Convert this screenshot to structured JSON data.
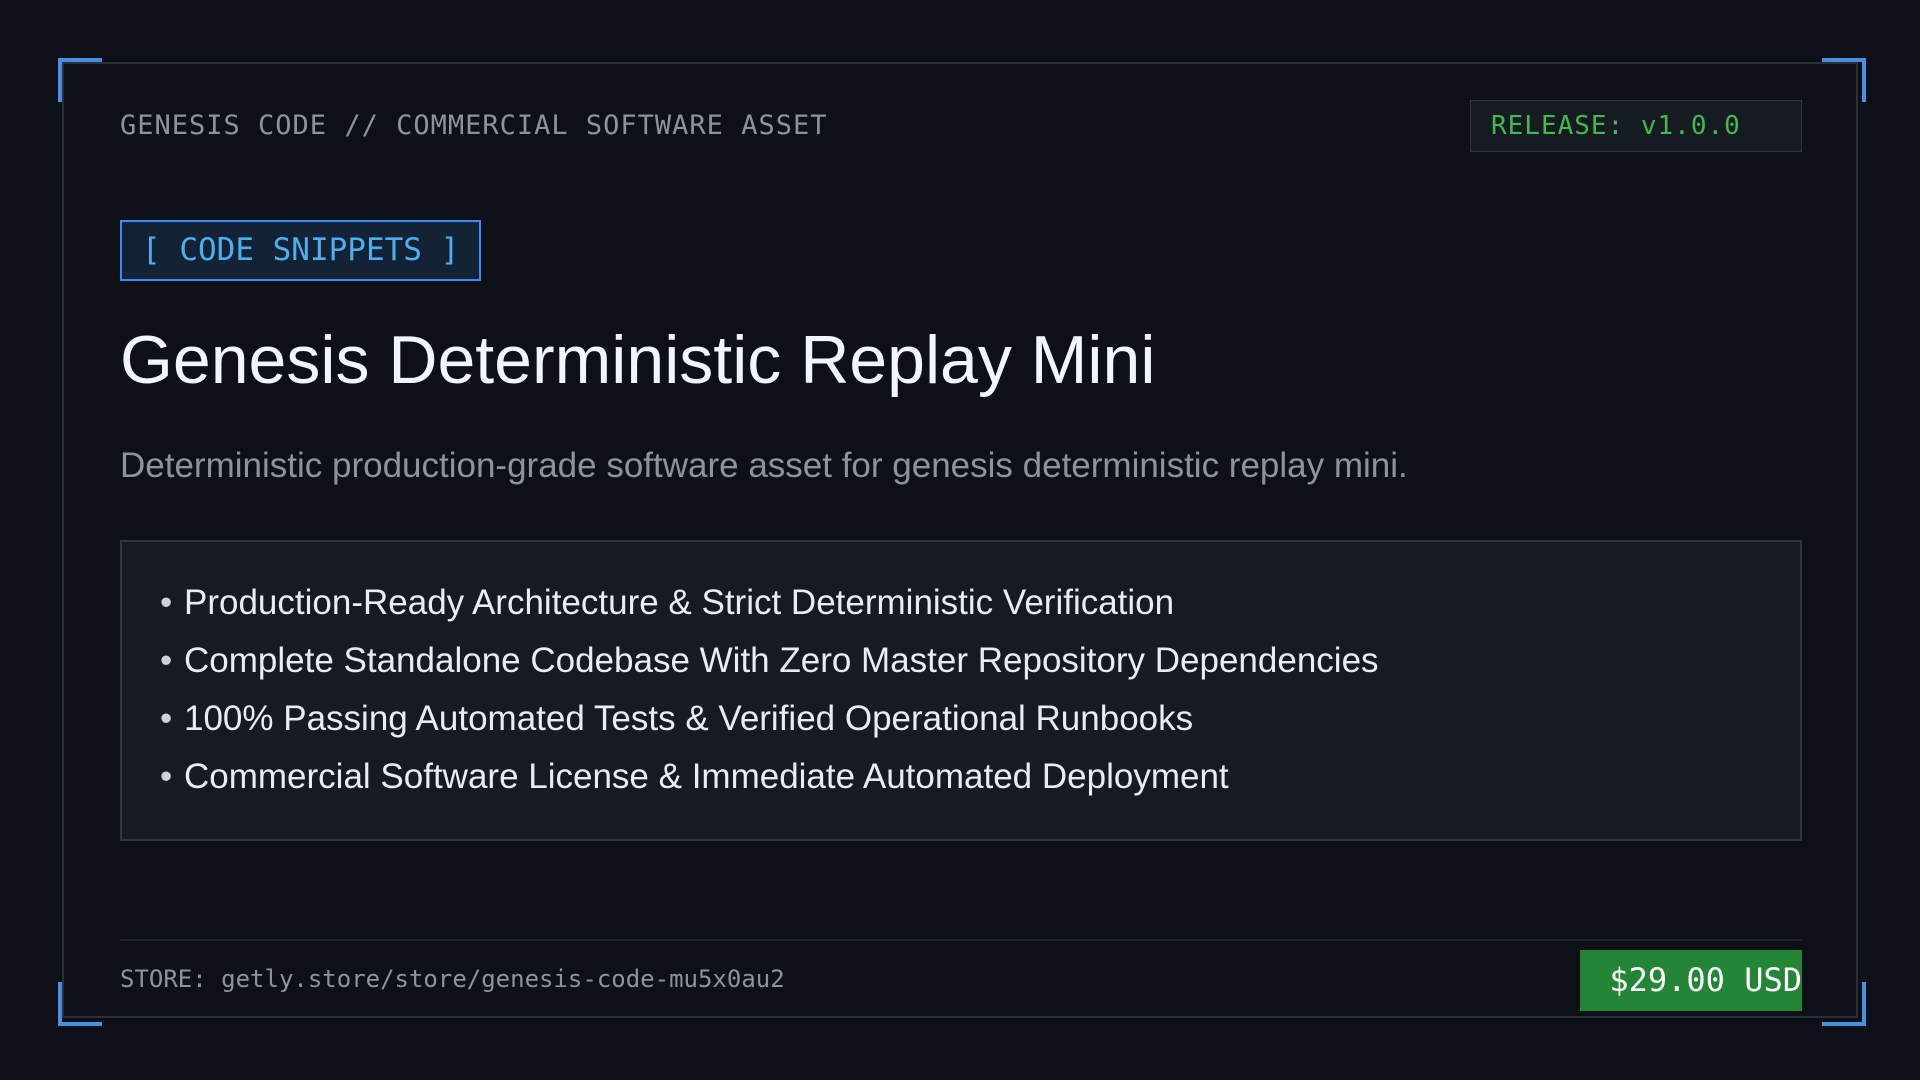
{
  "header": {
    "label": "GENESIS CODE // COMMERCIAL SOFTWARE ASSET",
    "release": "RELEASE: v1.0.0"
  },
  "product": {
    "category": "[ CODE SNIPPETS ]",
    "title": "Genesis Deterministic Replay Mini",
    "subtitle": "Deterministic production-grade software asset for genesis deterministic replay mini.",
    "features": [
      "Production-Ready Architecture & Strict Deterministic Verification",
      "Complete Standalone Codebase With Zero Master Repository Dependencies",
      "100% Passing Automated Tests & Verified Operational Runbooks",
      "Commercial Software License & Immediate Automated Deployment"
    ]
  },
  "footer": {
    "store": "STORE: getly.store/store/genesis-code-mu5x0au2",
    "price": "$29.00 USD"
  },
  "colors": {
    "background": "#0d1117",
    "accent_blue": "#4a90e2",
    "release_green": "#3fb950",
    "price_green": "#238636"
  }
}
